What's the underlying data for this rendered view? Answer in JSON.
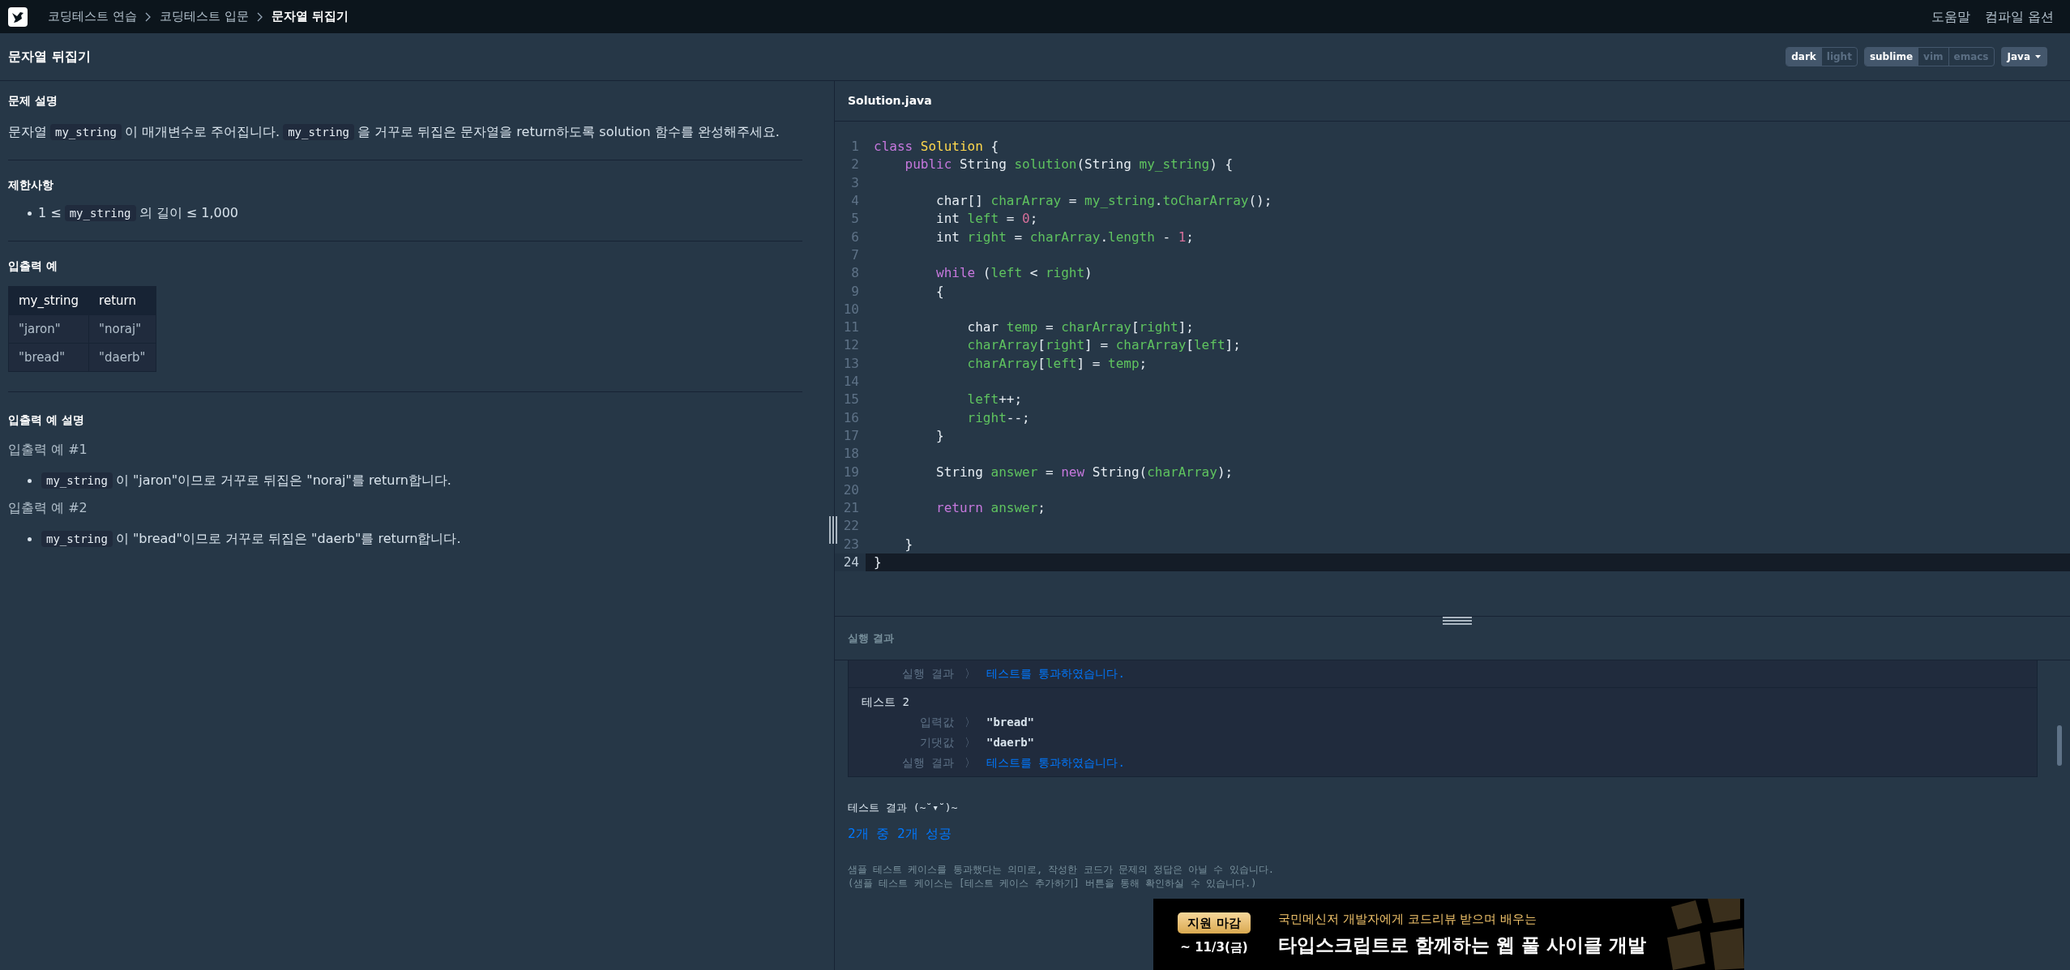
{
  "breadcrumbs": [
    {
      "label": "코딩테스트 연습",
      "current": false
    },
    {
      "label": "코딩테스트 입문",
      "current": false
    },
    {
      "label": "문자열 뒤집기",
      "current": true
    }
  ],
  "top_links": [
    "도움말",
    "컴파일 옵션"
  ],
  "title": "문자열 뒤집기",
  "theme_options": [
    {
      "label": "dark",
      "selected": true
    },
    {
      "label": "light",
      "selected": false
    }
  ],
  "keymap_options": [
    {
      "label": "sublime",
      "selected": true
    },
    {
      "label": "vim",
      "selected": false
    },
    {
      "label": "emacs",
      "selected": false
    }
  ],
  "language": "Java",
  "problem": {
    "heading": "문제 설명",
    "parts": [
      {
        "kind": "text",
        "text": "문자열"
      },
      {
        "kind": "code",
        "text": "my_string"
      },
      {
        "kind": "text",
        "text": "이 매개변수로 주어집니다."
      },
      {
        "kind": "code",
        "text": "my_string"
      },
      {
        "kind": "text",
        "text": "을 거꾸로 뒤집은 문자열을 return하도록 solution 함수를 완성해주세요."
      }
    ]
  },
  "constraints": {
    "heading": "제한사항",
    "items": [
      [
        {
          "kind": "text",
          "text": "1 ≤"
        },
        {
          "kind": "code",
          "text": "my_string"
        },
        {
          "kind": "text",
          "text": "의 길이 ≤ 1,000"
        }
      ]
    ]
  },
  "examples": {
    "heading": "입출력 예",
    "columns": [
      "my_string",
      "return"
    ],
    "rows": [
      [
        "\"jaron\"",
        "\"noraj\""
      ],
      [
        "\"bread\"",
        "\"daerb\""
      ]
    ]
  },
  "explanation": {
    "heading": "입출력 예 설명",
    "items": [
      {
        "title": "입출력 예 #1",
        "bullet": [
          {
            "kind": "code",
            "text": "my_string"
          },
          {
            "kind": "text",
            "text": "이 \"jaron\"이므로 거꾸로 뒤집은 \"noraj\"를 return합니다."
          }
        ]
      },
      {
        "title": "입출력 예 #2",
        "bullet": [
          {
            "kind": "code",
            "text": "my_string"
          },
          {
            "kind": "text",
            "text": "이 \"bread\"이므로 거꾸로 뒤집은 \"daerb\"를 return합니다."
          }
        ]
      }
    ]
  },
  "editor": {
    "filename": "Solution.java",
    "lines": [
      {
        "number": "1",
        "active": false,
        "tokens": [
          {
            "kind": "keyword",
            "text": "class"
          },
          {
            "kind": "type",
            "text": " Solution"
          },
          {
            "kind": "plain",
            "text": " {"
          }
        ]
      },
      {
        "number": "2",
        "active": false,
        "tokens": [
          {
            "kind": "keyword",
            "text": "    public"
          },
          {
            "kind": "plain",
            "text": " String "
          },
          {
            "kind": "name",
            "text": "solution"
          },
          {
            "kind": "plain",
            "text": "(String "
          },
          {
            "kind": "name",
            "text": "my_string"
          },
          {
            "kind": "plain",
            "text": ") {"
          }
        ]
      },
      {
        "number": "3",
        "active": false
      },
      {
        "number": "4",
        "active": false,
        "tokens": [
          {
            "kind": "plain",
            "text": "        char[] "
          },
          {
            "kind": "name",
            "text": "charArray"
          },
          {
            "kind": "plain",
            "text": " = "
          },
          {
            "kind": "name",
            "text": "my_string"
          },
          {
            "kind": "plain",
            "text": "."
          },
          {
            "kind": "name",
            "text": "toCharArray"
          },
          {
            "kind": "plain",
            "text": "();"
          }
        ]
      },
      {
        "number": "5",
        "active": false,
        "tokens": [
          {
            "kind": "plain",
            "text": "        int "
          },
          {
            "kind": "name",
            "text": "left"
          },
          {
            "kind": "plain",
            "text": " = "
          },
          {
            "kind": "number",
            "text": "0"
          },
          {
            "kind": "plain",
            "text": ";"
          }
        ]
      },
      {
        "number": "6",
        "active": false,
        "tokens": [
          {
            "kind": "plain",
            "text": "        int "
          },
          {
            "kind": "name",
            "text": "right"
          },
          {
            "kind": "plain",
            "text": " = "
          },
          {
            "kind": "name",
            "text": "charArray"
          },
          {
            "kind": "plain",
            "text": "."
          },
          {
            "kind": "name",
            "text": "length"
          },
          {
            "kind": "plain",
            "text": " - "
          },
          {
            "kind": "number",
            "text": "1"
          },
          {
            "kind": "plain",
            "text": ";"
          }
        ]
      },
      {
        "number": "7",
        "active": false
      },
      {
        "number": "8",
        "active": false,
        "tokens": [
          {
            "kind": "keyword",
            "text": "        while"
          },
          {
            "kind": "plain",
            "text": " ("
          },
          {
            "kind": "name",
            "text": "left"
          },
          {
            "kind": "plain",
            "text": " < "
          },
          {
            "kind": "name",
            "text": "right"
          },
          {
            "kind": "plain",
            "text": ")"
          }
        ]
      },
      {
        "number": "9",
        "active": false,
        "tokens": [
          {
            "kind": "plain",
            "text": "        {"
          }
        ]
      },
      {
        "number": "10",
        "active": false
      },
      {
        "number": "11",
        "active": false,
        "tokens": [
          {
            "kind": "plain",
            "text": "            char "
          },
          {
            "kind": "name",
            "text": "temp"
          },
          {
            "kind": "plain",
            "text": " = "
          },
          {
            "kind": "name",
            "text": "charArray"
          },
          {
            "kind": "plain",
            "text": "["
          },
          {
            "kind": "name",
            "text": "right"
          },
          {
            "kind": "plain",
            "text": "];"
          }
        ]
      },
      {
        "number": "12",
        "active": false,
        "tokens": [
          {
            "kind": "name",
            "text": "            charArray"
          },
          {
            "kind": "plain",
            "text": "["
          },
          {
            "kind": "name",
            "text": "right"
          },
          {
            "kind": "plain",
            "text": "] = "
          },
          {
            "kind": "name",
            "text": "charArray"
          },
          {
            "kind": "plain",
            "text": "["
          },
          {
            "kind": "name",
            "text": "left"
          },
          {
            "kind": "plain",
            "text": "];"
          }
        ]
      },
      {
        "number": "13",
        "active": false,
        "tokens": [
          {
            "kind": "name",
            "text": "            charArray"
          },
          {
            "kind": "plain",
            "text": "["
          },
          {
            "kind": "name",
            "text": "left"
          },
          {
            "kind": "plain",
            "text": "] = "
          },
          {
            "kind": "name",
            "text": "temp"
          },
          {
            "kind": "plain",
            "text": ";"
          }
        ]
      },
      {
        "number": "14",
        "active": false
      },
      {
        "number": "15",
        "active": false,
        "tokens": [
          {
            "kind": "name",
            "text": "            left"
          },
          {
            "kind": "plain",
            "text": "++;"
          }
        ]
      },
      {
        "number": "16",
        "active": false,
        "tokens": [
          {
            "kind": "name",
            "text": "            right"
          },
          {
            "kind": "plain",
            "text": "--;"
          }
        ]
      },
      {
        "number": "17",
        "active": false,
        "tokens": [
          {
            "kind": "plain",
            "text": "        }"
          }
        ]
      },
      {
        "number": "18",
        "active": false
      },
      {
        "number": "19",
        "active": false,
        "tokens": [
          {
            "kind": "plain",
            "text": "        String "
          },
          {
            "kind": "name",
            "text": "answer"
          },
          {
            "kind": "plain",
            "text": " = "
          },
          {
            "kind": "keyword",
            "text": "new"
          },
          {
            "kind": "plain",
            "text": " String("
          },
          {
            "kind": "name",
            "text": "charArray"
          },
          {
            "kind": "plain",
            "text": ");"
          }
        ]
      },
      {
        "number": "20",
        "active": false
      },
      {
        "number": "21",
        "active": false,
        "tokens": [
          {
            "kind": "keyword",
            "text": "        return"
          },
          {
            "kind": "name",
            "text": " answer"
          },
          {
            "kind": "plain",
            "text": ";"
          }
        ]
      },
      {
        "number": "22",
        "active": false
      },
      {
        "number": "23",
        "active": false,
        "tokens": [
          {
            "kind": "plain",
            "text": "    }"
          }
        ]
      },
      {
        "number": "24",
        "active": true,
        "tokens": [
          {
            "kind": "plain",
            "text": "}"
          }
        ]
      }
    ]
  },
  "results": {
    "title": "실행 결과",
    "tests": [
      {
        "rows": [
          {
            "label": "실행 결과",
            "arrow": "〉",
            "value": "테스트를 통과하였습니다.",
            "kind": "pass"
          }
        ]
      },
      {
        "title": "테스트 2",
        "rows": [
          {
            "label": "입력값",
            "arrow": "〉",
            "value": "\"bread\"",
            "kind": "plain"
          },
          {
            "label": "기댓값",
            "arrow": "〉",
            "value": "\"daerb\"",
            "kind": "plain"
          },
          {
            "label": "실행 결과",
            "arrow": "〉",
            "value": "테스트를 통과하였습니다.",
            "kind": "pass"
          }
        ]
      }
    ],
    "summary_title": "테스트 결과 (~˘▾˘)~",
    "summary": "2개 중 2개 성공",
    "notes": [
      "샘플 테스트 케이스를 통과했다는 의미로, 작성한 코드가 문제의 정답은 아닐 수 있습니다.",
      "(샘플 테스트 케이스는 [테스트 케이스 추가하기] 버튼을 통해 확인하실 수 있습니다.)"
    ]
  },
  "banner": {
    "badge": "지원 마감",
    "deadline": "~ 11/3(금)",
    "subtitle": "국민메신저 개발자에게 코드리뷰 받으며 배우는",
    "headline": "타입스크립트로 함께하는 웹 풀 사이클 개발"
  }
}
